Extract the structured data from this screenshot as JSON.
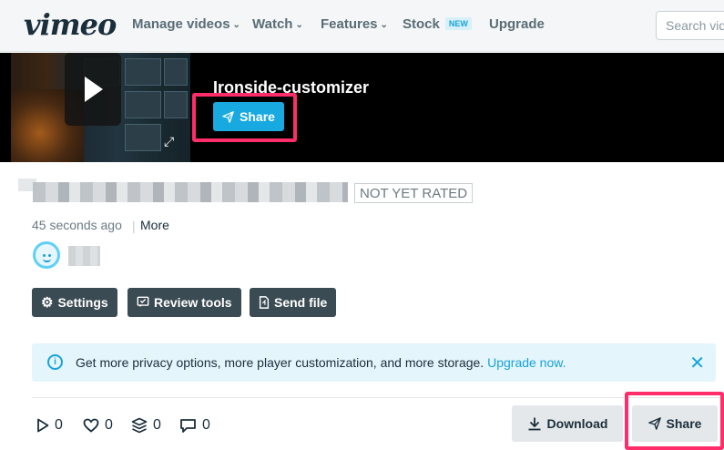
{
  "nav": {
    "logo": "vimeo",
    "items": [
      {
        "label": "Manage videos",
        "dropdown": true
      },
      {
        "label": "Watch",
        "dropdown": true
      },
      {
        "label": "Features",
        "dropdown": true
      },
      {
        "label": "Stock",
        "badge": "NEW"
      },
      {
        "label": "Upgrade"
      }
    ],
    "search_placeholder": "Search videos"
  },
  "video": {
    "title": "Ironside-customizer",
    "share_label": "Share"
  },
  "meta": {
    "rating": "NOT YET RATED",
    "posted": "45 seconds ago",
    "more": "More"
  },
  "actions": {
    "settings": "Settings",
    "review": "Review tools",
    "send_file": "Send file"
  },
  "banner": {
    "message": "Get more privacy options, more player customization, and more storage.",
    "link": "Upgrade now."
  },
  "stats": {
    "plays": "0",
    "likes": "0",
    "collections": "0",
    "comments": "0"
  },
  "footer": {
    "download": "Download",
    "share": "Share"
  },
  "colors": {
    "accent": "#17a9e0",
    "highlight": "#ff2d6a",
    "button_dark": "#3b4b54"
  }
}
